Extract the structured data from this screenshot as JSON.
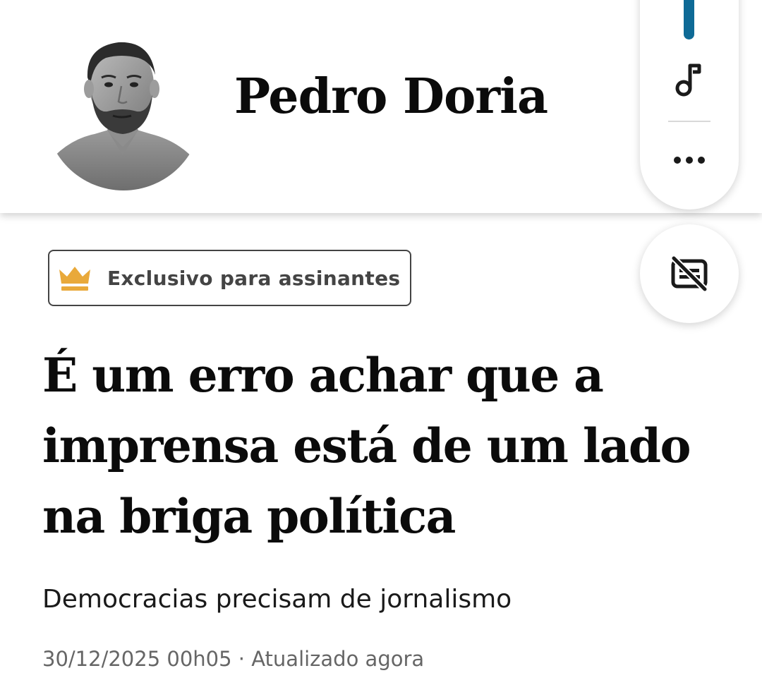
{
  "author": {
    "name": "Pedro Doria",
    "avatar_icon": "author-photo"
  },
  "toolbar": {
    "progress_color": "#0e6a96",
    "audio_icon": "music-note-icon",
    "more_icon": "more-dots-icon",
    "subtitles_icon": "subtitles-off-icon"
  },
  "article": {
    "badge": {
      "icon": "crown-icon",
      "icon_color": "#e9a93a",
      "label": "Exclusivo para assinantes"
    },
    "headline": "É um erro achar que a imprensa está de um lado na briga política",
    "subtitle": "Democracias precisam de jornalismo",
    "meta": {
      "date": "30/12/2025 00h05",
      "separator": "·",
      "updated": "Atualizado agora"
    }
  }
}
